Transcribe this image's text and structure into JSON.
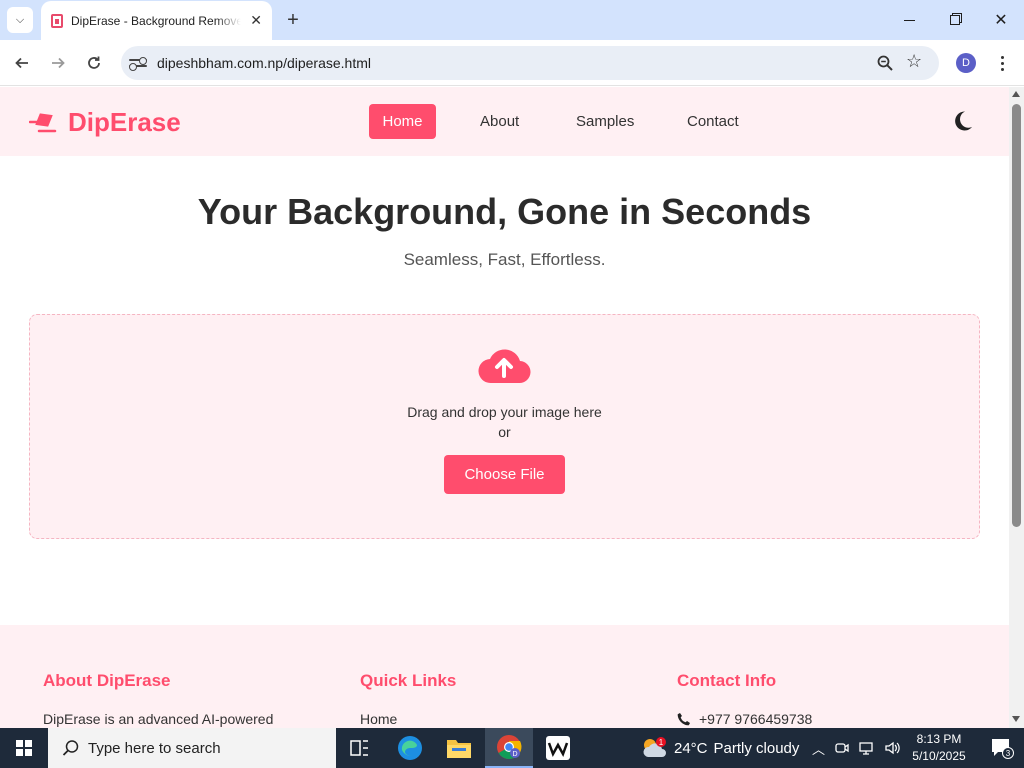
{
  "browser": {
    "tab_title": "DipErase - Background Remover",
    "tab_close": "✕",
    "new_tab": "+",
    "url": "dipeshbham.com.np/diperase.html",
    "profile_initial": "D",
    "icons": [
      "back-arrow-icon",
      "forward-arrow-icon",
      "reload-icon",
      "site-info-icon",
      "zoom-icon",
      "star-icon",
      "kebab-menu-icon"
    ]
  },
  "site": {
    "brand": "DipErase",
    "brand_color": "#ff4d6d",
    "nav": {
      "home": "Home",
      "about": "About",
      "samples": "Samples",
      "contact": "Contact"
    },
    "hero": {
      "title": "Your Background, Gone in Seconds",
      "subtitle": "Seamless, Fast, Effortless."
    },
    "upload": {
      "drop_text": "Drag and drop your image here",
      "or_text": "or",
      "button": "Choose File"
    },
    "footer": {
      "about_title": "About DipErase",
      "about_text": "DipErase is an advanced AI-powered",
      "links_title": "Quick Links",
      "links_first": "Home",
      "contact_title": "Contact Info",
      "phone": "+977 9766459738"
    }
  },
  "taskbar": {
    "search_placeholder": "Type here to search",
    "weather_temp": "24°C",
    "weather_text": "Partly cloudy",
    "weather_badge": "1",
    "time": "8:13 PM",
    "date": "5/10/2025",
    "notif_count": "3"
  }
}
